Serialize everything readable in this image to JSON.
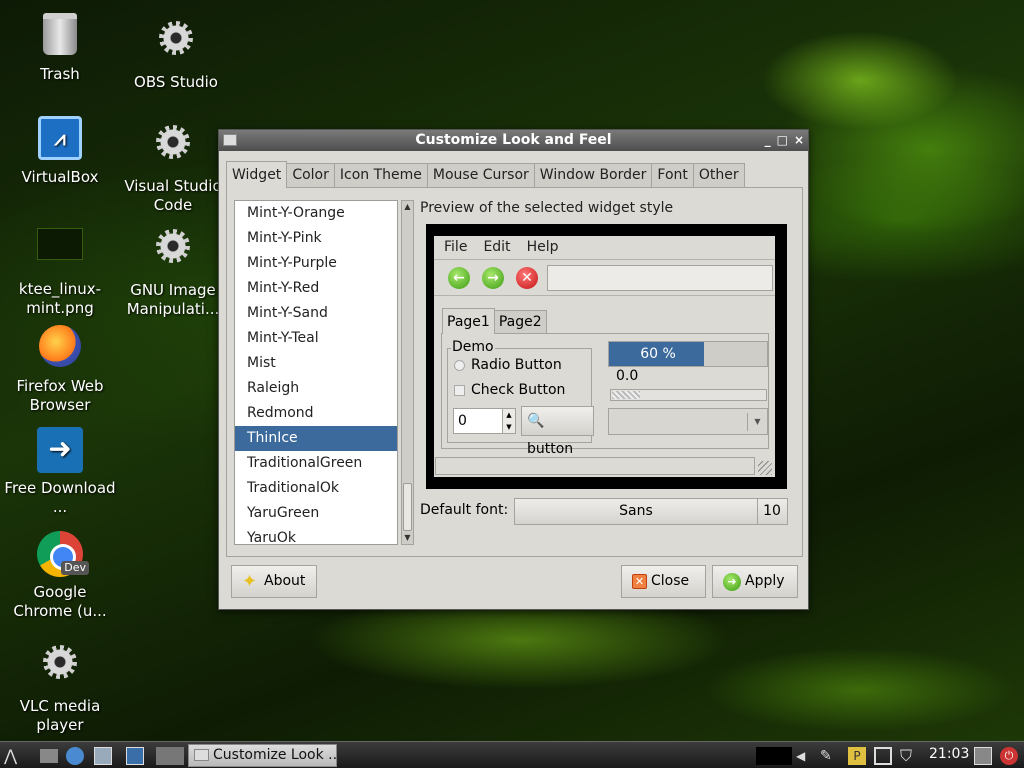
{
  "desktop": {
    "icons": [
      {
        "label": "Trash"
      },
      {
        "label": "OBS Studio"
      },
      {
        "label": "VirtualBox"
      },
      {
        "label": "Visual Studio Code"
      },
      {
        "label": "ktee_linux-mint.png"
      },
      {
        "label": "GNU Image Manipulati..."
      },
      {
        "label": "Firefox Web Browser"
      },
      {
        "label": "Free Download ..."
      },
      {
        "label": "Google Chrome (u...",
        "badge": "Dev"
      },
      {
        "label": "VLC media player"
      }
    ]
  },
  "window": {
    "title": "Customize Look and Feel",
    "controls": {
      "minimize": "_",
      "maximize": "□",
      "close": "×"
    },
    "tabs": [
      "Widget",
      "Color",
      "Icon Theme",
      "Mouse Cursor",
      "Window Border",
      "Font",
      "Other"
    ],
    "active_tab": "Widget",
    "themes": [
      "Mint-Y-Orange",
      "Mint-Y-Pink",
      "Mint-Y-Purple",
      "Mint-Y-Red",
      "Mint-Y-Sand",
      "Mint-Y-Teal",
      "Mist",
      "Raleigh",
      "Redmond",
      "ThinIce",
      "TraditionalGreen",
      "TraditionalOk",
      "YaruGreen",
      "YaruOk"
    ],
    "selected_theme": "ThinIce",
    "preview": {
      "label": "Preview of the selected widget style",
      "menu": [
        "File",
        "Edit",
        "Help"
      ],
      "tabs": [
        "Page1",
        "Page2"
      ],
      "demo_legend": "Demo",
      "radio_label": "Radio Button",
      "check_label": "Check Button",
      "spin_value": "0",
      "button_label": "button",
      "progress_percent": 60,
      "progress_text": "60 %",
      "scale_value": "0.0"
    },
    "font": {
      "label": "Default font:",
      "name": "Sans",
      "size": "10"
    },
    "buttons": {
      "about": "About",
      "close": "Close",
      "apply": "Apply"
    }
  },
  "taskbar": {
    "task_label": "Customize Look ...",
    "clock": "21:03"
  },
  "colors": {
    "selection": "#3d6a9c",
    "window_bg": "#dcdad5"
  }
}
